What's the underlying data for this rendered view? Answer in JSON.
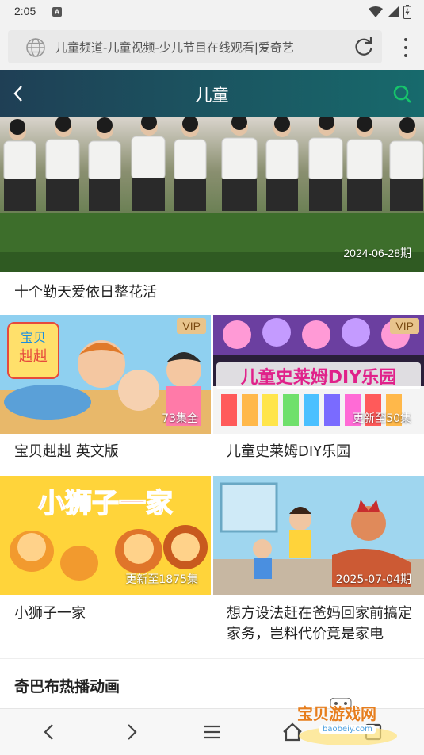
{
  "status_bar": {
    "time": "2:05",
    "a_icon": "A"
  },
  "browser": {
    "url_text": "儿童频道-儿童视频-少儿节目在线观看|爱奇艺"
  },
  "channel": {
    "title": "儿童",
    "accent": "#16c36b"
  },
  "hero": {
    "date": "2024-06-28期",
    "caption": "十个勤天爱依日整花活"
  },
  "cards": [
    {
      "title": "宝贝赳赳 英文版",
      "meta": "73集全",
      "vip": "VIP"
    },
    {
      "title": "儿童史莱姆DIY乐园",
      "meta": "更新至50集",
      "vip": "VIP"
    },
    {
      "title": "小狮子一家",
      "meta": "更新至1875集"
    },
    {
      "title": "想方设法赶在爸妈回家前搞定家务，岂料代价竟是家电",
      "meta": "2025-07-04期"
    }
  ],
  "section": {
    "title": "奇巴布热播动画"
  },
  "watermark": {
    "text": "宝贝游戏网",
    "domain": "baobeiy.com"
  },
  "icons": [
    "globe-icon",
    "reload-icon",
    "kebab-menu-icon",
    "back-icon",
    "search-icon",
    "nav-back-icon",
    "nav-forward-icon",
    "nav-menu-icon",
    "nav-home-icon",
    "nav-tabs-icon"
  ]
}
